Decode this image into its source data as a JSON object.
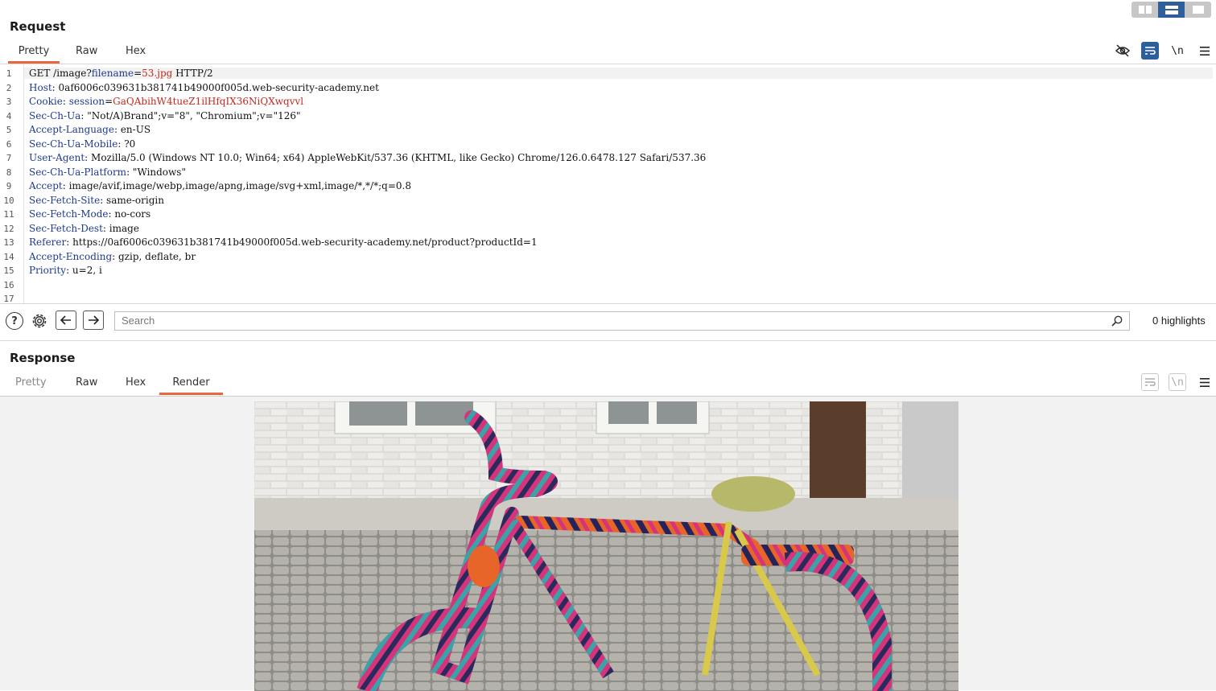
{
  "request": {
    "title": "Request",
    "tabs": [
      "Pretty",
      "Raw",
      "Hex"
    ],
    "active_tab": "Pretty",
    "toolbar": {
      "newline_label": "\\n"
    },
    "lines": [
      {
        "n": "1",
        "parts": [
          [
            "GET /image?",
            ""
          ],
          [
            "filename",
            "k"
          ],
          [
            "=",
            ""
          ],
          [
            "53.jpg",
            "s"
          ],
          [
            " HTTP/2",
            ""
          ]
        ]
      },
      {
        "n": "2",
        "parts": [
          [
            "Host",
            "k"
          ],
          [
            ": 0af6006c039631b381741b49000f005d.web-security-academy.net",
            ""
          ]
        ]
      },
      {
        "n": "3",
        "parts": [
          [
            "Cookie",
            "k"
          ],
          [
            ": ",
            ""
          ],
          [
            "session",
            "k"
          ],
          [
            "=",
            ""
          ],
          [
            "GaQAbihW4tueZ1ilHfqIX36NiQXwqvvl",
            "s"
          ]
        ]
      },
      {
        "n": "4",
        "parts": [
          [
            "Sec-Ch-Ua",
            "k"
          ],
          [
            ": \"Not/A)Brand\";v=\"8\", \"Chromium\";v=\"126\"",
            ""
          ]
        ]
      },
      {
        "n": "5",
        "parts": [
          [
            "Accept-Language",
            "k"
          ],
          [
            ": en-US",
            ""
          ]
        ]
      },
      {
        "n": "6",
        "parts": [
          [
            "Sec-Ch-Ua-Mobile",
            "k"
          ],
          [
            ": ?0",
            ""
          ]
        ]
      },
      {
        "n": "7",
        "parts": [
          [
            "User-Agent",
            "k"
          ],
          [
            ": Mozilla/5.0 (Windows NT 10.0; Win64; x64) AppleWebKit/537.36 (KHTML, like Gecko) Chrome/126.0.6478.127 Safari/537.36",
            ""
          ]
        ]
      },
      {
        "n": "8",
        "parts": [
          [
            "Sec-Ch-Ua-Platform",
            "k"
          ],
          [
            ": \"Windows\"",
            ""
          ]
        ]
      },
      {
        "n": "9",
        "parts": [
          [
            "Accept",
            "k"
          ],
          [
            ": image/avif,image/webp,image/apng,image/svg+xml,image/*,*/*;q=0.8",
            ""
          ]
        ]
      },
      {
        "n": "10",
        "parts": [
          [
            "Sec-Fetch-Site",
            "k"
          ],
          [
            ": same-origin",
            ""
          ]
        ]
      },
      {
        "n": "11",
        "parts": [
          [
            "Sec-Fetch-Mode",
            "k"
          ],
          [
            ": no-cors",
            ""
          ]
        ]
      },
      {
        "n": "12",
        "parts": [
          [
            "Sec-Fetch-Dest",
            "k"
          ],
          [
            ": image",
            ""
          ]
        ]
      },
      {
        "n": "13",
        "parts": [
          [
            "Referer",
            "k"
          ],
          [
            ": https://0af6006c039631b381741b49000f005d.web-security-academy.net/product?productId=1",
            ""
          ]
        ]
      },
      {
        "n": "14",
        "parts": [
          [
            "Accept-Encoding",
            "k"
          ],
          [
            ": gzip, deflate, br",
            ""
          ]
        ]
      },
      {
        "n": "15",
        "parts": [
          [
            "Priority",
            "k"
          ],
          [
            ": u=2, i",
            ""
          ]
        ]
      },
      {
        "n": "16",
        "parts": []
      },
      {
        "n": "17",
        "parts": []
      }
    ]
  },
  "search": {
    "placeholder": "Search",
    "highlights": "0 highlights"
  },
  "response": {
    "title": "Response",
    "tabs": [
      "Pretty",
      "Raw",
      "Hex",
      "Render"
    ],
    "active_tab": "Render",
    "toolbar": {
      "newline_label": "\\n"
    }
  },
  "colors": {
    "accent": "#e8663d",
    "header_key": "#1e3a8f",
    "value_red": "#c4281d",
    "selected_layout": "#2f5f9a"
  }
}
